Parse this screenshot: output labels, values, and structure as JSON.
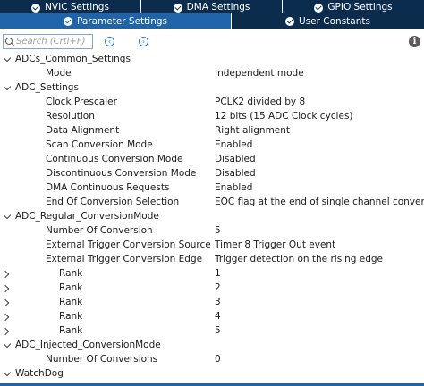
{
  "tabs_top": [
    "NVIC Settings",
    "DMA Settings",
    "GPIO Settings"
  ],
  "tabs_second": [
    "Parameter Settings",
    "User Constants"
  ],
  "search": {
    "placeholder": "Search (Crtl+F)"
  },
  "icons": {
    "search": "magnifier-icon",
    "prev": "chevron-left-circle-icon",
    "next": "chevron-right-circle-icon",
    "info": "info-icon",
    "check": "check-circle-icon"
  },
  "colors": {
    "tab_bar": "#0c2c4e",
    "active_tab": "#1f63a8",
    "accent": "#2f7bd8"
  },
  "tree": {
    "adcs_common": {
      "label": "ADCs_Common_Settings",
      "mode": {
        "label": "Mode",
        "value": "Independent mode"
      }
    },
    "adc_settings": {
      "label": "ADC_Settings",
      "items": [
        {
          "label": "Clock Prescaler",
          "value": "PCLK2 divided by 8"
        },
        {
          "label": "Resolution",
          "value": "12 bits (15 ADC Clock cycles)"
        },
        {
          "label": "Data Alignment",
          "value": "Right alignment"
        },
        {
          "label": "Scan Conversion Mode",
          "value": "Enabled"
        },
        {
          "label": "Continuous Conversion Mode",
          "value": "Disabled"
        },
        {
          "label": "Discontinuous Conversion Mode",
          "value": "Disabled"
        },
        {
          "label": "DMA Continuous Requests",
          "value": "Enabled"
        },
        {
          "label": "End Of Conversion Selection",
          "value": "EOC flag at the end of single channel conversion"
        }
      ]
    },
    "regular": {
      "label": "ADC_Regular_ConversionMode",
      "items": [
        {
          "label": "Number Of Conversion",
          "value": "5"
        },
        {
          "label": "External Trigger Conversion Source",
          "value": "Timer 8 Trigger Out event"
        },
        {
          "label": "External Trigger Conversion Edge",
          "value": "Trigger detection on the rising edge"
        }
      ],
      "ranks": [
        {
          "label": "Rank",
          "value": "1"
        },
        {
          "label": "Rank",
          "value": "2"
        },
        {
          "label": "Rank",
          "value": "3"
        },
        {
          "label": "Rank",
          "value": "4"
        },
        {
          "label": "Rank",
          "value": "5"
        }
      ]
    },
    "injected": {
      "label": "ADC_Injected_ConversionMode",
      "items": [
        {
          "label": "Number Of Conversions",
          "value": "0"
        }
      ]
    },
    "watchdog": {
      "label": "WatchDog"
    }
  }
}
